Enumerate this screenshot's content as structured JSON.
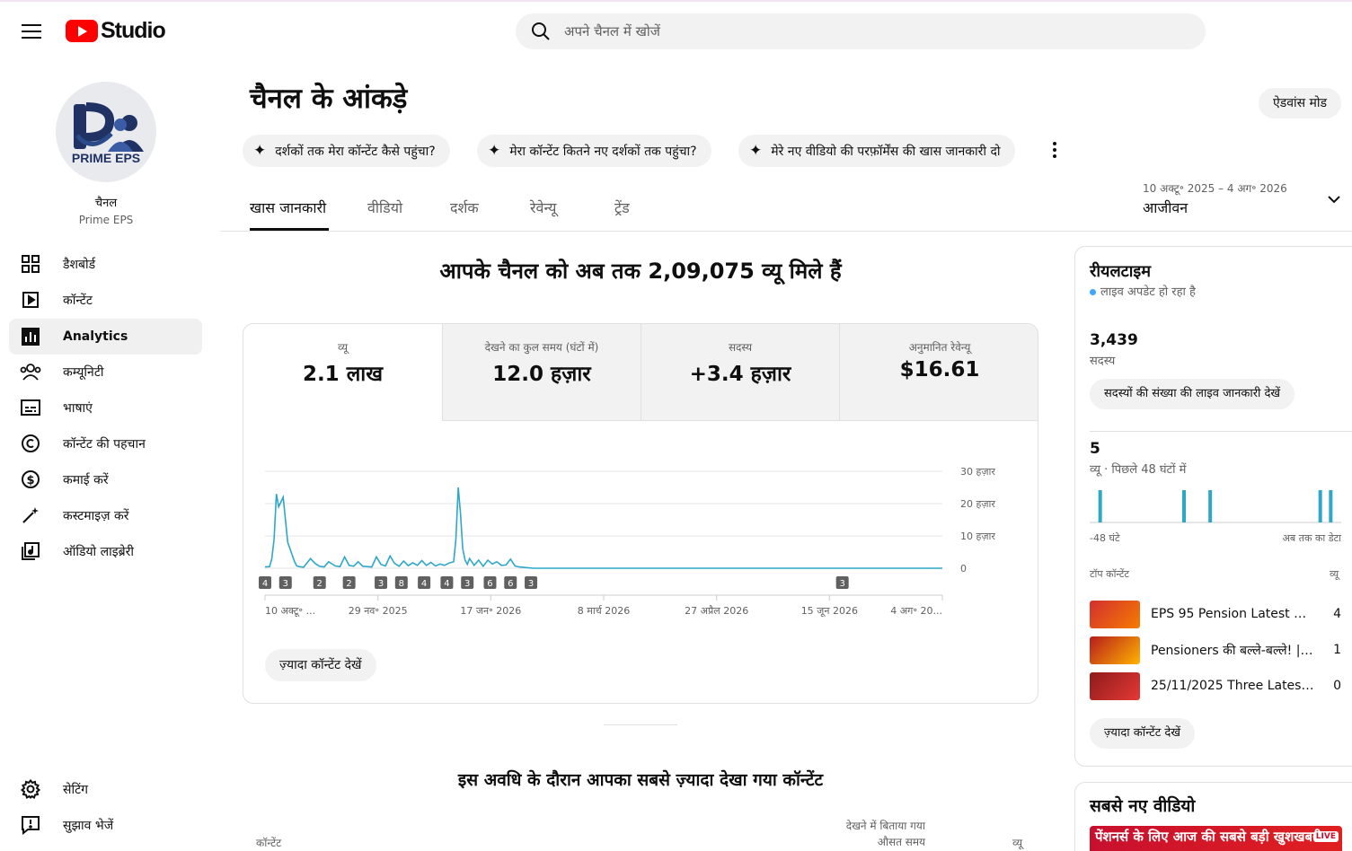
{
  "app": {
    "logo_text": "Studio"
  },
  "search": {
    "placeholder": "अपने चैनल में खोजें"
  },
  "channel": {
    "label": "चैनल",
    "name": "Prime EPS",
    "avatar_text": "PRIME EPS"
  },
  "sidebar": {
    "items": [
      {
        "label": "डैशबोर्ड",
        "icon": "dashboard-icon"
      },
      {
        "label": "कॉन्टेंट",
        "icon": "content-icon"
      },
      {
        "label": "Analytics",
        "icon": "analytics-icon",
        "active": true
      },
      {
        "label": "कम्यूनिटी",
        "icon": "community-icon"
      },
      {
        "label": "भाषाएं",
        "icon": "subtitles-icon"
      },
      {
        "label": "कॉन्टेंट की पहचान",
        "icon": "copyright-icon"
      },
      {
        "label": "कमाई करें",
        "icon": "dollar-icon"
      },
      {
        "label": "कस्टमाइज़ करें",
        "icon": "magic-wand-icon"
      },
      {
        "label": "ऑडियो लाइब्रेरी",
        "icon": "audio-library-icon"
      }
    ],
    "bottom": [
      {
        "label": "सेटिंग",
        "icon": "gear-icon"
      },
      {
        "label": "सुझाव भेजें",
        "icon": "feedback-icon"
      }
    ]
  },
  "main": {
    "title": "चैनल के आंकड़े",
    "advanced_mode": "ऐडवांस मोड",
    "chips": [
      "दर्शकों तक मेरा कॉन्टेंट कैसे पहुंचा?",
      "मेरा कॉन्टेंट कितने नए दर्शकों तक पहुंचा?",
      "मेरे नए वीडियो की परफ़ॉर्मेंस की खास जानकारी दो"
    ],
    "tabs": [
      "खास जानकारी",
      "वीडियो",
      "दर्शक",
      "रेवेन्यू",
      "ट्रेंड"
    ],
    "date_range": {
      "dates": "10 अक्टू॰ 2025 – 4 अग॰ 2026",
      "label": "आजीवन"
    },
    "headline": "आपके चैनल को अब तक 2,09,075 व्यू मिले हैं",
    "metrics": [
      {
        "label": "व्यू",
        "value": "2.1 लाख"
      },
      {
        "label": "देखने का कुल समय (घंटों में)",
        "value": "12.0 हज़ार"
      },
      {
        "label": "सदस्य",
        "value": "+3.4 हज़ार"
      },
      {
        "label": "अनुमानित रेवेन्यू",
        "value": "$16.61"
      }
    ],
    "more_content": "ज़्यादा कॉन्टेंट देखें",
    "top_content_title": "इस अवधि के दौरान आपका सबसे ज़्यादा देखा गया कॉन्टेंट",
    "table_headers": {
      "content": "कॉन्टेंट",
      "avg_watch_line1": "देखने में बिताया गया",
      "avg_watch_line2": "औसत समय",
      "views": "व्यू"
    }
  },
  "chart_data": {
    "type": "line",
    "x": [
      "2025-10-10",
      "2025-10-12",
      "2025-10-13",
      "2025-10-14",
      "2025-10-15",
      "2025-10-16",
      "2025-10-18",
      "2025-10-20",
      "2025-10-23",
      "2025-10-24",
      "2025-10-25",
      "2025-10-27",
      "2025-10-30",
      "2025-11-01",
      "2025-11-03",
      "2025-11-05",
      "2025-11-07",
      "2025-11-10",
      "2025-11-12",
      "2025-11-14",
      "2025-11-16",
      "2025-11-18",
      "2025-11-20",
      "2025-11-22",
      "2025-11-24",
      "2025-11-26",
      "2025-11-28",
      "2025-11-30",
      "2025-12-02",
      "2025-12-04",
      "2025-12-06",
      "2025-12-08",
      "2025-12-10",
      "2025-12-12",
      "2025-12-14",
      "2025-12-16",
      "2025-12-18",
      "2025-12-20",
      "2025-12-22",
      "2025-12-24",
      "2025-12-26",
      "2025-12-28",
      "2025-12-30",
      "2026-01-01",
      "2026-01-02",
      "2026-01-03",
      "2026-01-04",
      "2026-01-05",
      "2026-01-06",
      "2026-01-07",
      "2026-01-08",
      "2026-01-10",
      "2026-01-12",
      "2026-01-14",
      "2026-01-16",
      "2026-01-18",
      "2026-01-20",
      "2026-01-22",
      "2026-01-24",
      "2026-01-26",
      "2026-01-28",
      "2026-01-30",
      "2026-02-02",
      "2026-02-05",
      "2026-03-01",
      "2026-04-15",
      "2026-06-01",
      "2026-07-15",
      "2026-08-04"
    ],
    "y": [
      400,
      500,
      3000,
      9000,
      23000,
      19000,
      22000,
      8000,
      2000,
      700,
      500,
      300,
      3000,
      1500,
      600,
      400,
      2000,
      700,
      500,
      3500,
      900,
      600,
      2000,
      600,
      500,
      400,
      3500,
      1200,
      700,
      3800,
      1500,
      600,
      2200,
      800,
      1700,
      900,
      2400,
      900,
      1800,
      700,
      1300,
      900,
      1600,
      2000,
      9000,
      25000,
      17000,
      6000,
      2500,
      1200,
      3000,
      900,
      2500,
      600,
      2500,
      1300,
      2000,
      900,
      1000,
      2800,
      700,
      400,
      200,
      0,
      0,
      0,
      0,
      0,
      0
    ],
    "xtick_labels": [
      "10 अक्टू॰ ...",
      "29 नव॰ 2025",
      "17 जन॰ 2026",
      "8 मार्च 2026",
      "27 अप्रैल 2026",
      "15 जून 2026",
      "4 अग॰ 20..."
    ],
    "ytick_labels": [
      "30 हज़ार",
      "20 हज़ार",
      "10 हज़ार",
      "0"
    ],
    "ylim": [
      0,
      30000
    ],
    "xlim": [
      "2025-10-10",
      "2026-08-04"
    ],
    "grid": true,
    "color": "#2fa7c9",
    "markers": [
      {
        "x": "2025-10-10",
        "label": "4"
      },
      {
        "x": "2025-10-19",
        "label": "3"
      },
      {
        "x": "2025-11-03",
        "label": "2"
      },
      {
        "x": "2025-11-16",
        "label": "2"
      },
      {
        "x": "2025-11-30",
        "label": "3"
      },
      {
        "x": "2025-12-09",
        "label": "8"
      },
      {
        "x": "2025-12-19",
        "label": "4"
      },
      {
        "x": "2025-12-29",
        "label": "4"
      },
      {
        "x": "2026-01-07",
        "label": "3"
      },
      {
        "x": "2026-01-17",
        "label": "6"
      },
      {
        "x": "2026-01-26",
        "label": "6"
      },
      {
        "x": "2026-02-04",
        "label": "3"
      },
      {
        "x": "2026-06-21",
        "label": "3"
      }
    ]
  },
  "realtime": {
    "title": "रीयलटाइम",
    "live_text": "लाइव अपडेट हो रहा है",
    "subscribers": "3,439",
    "subscribers_label": "सदस्य",
    "subscribers_btn": "सदस्यों की संख्या की लाइव जानकारी देखें",
    "views": "5",
    "views_label": "व्यू · पिछले 48 घंटों में",
    "bar_start": "-48 घंटे",
    "bar_end": "अब तक का डेटा",
    "bars": {
      "hours_ago": [
        46,
        30,
        25,
        4,
        2
      ],
      "values": [
        1,
        1,
        1,
        1,
        1
      ]
    },
    "top_content_header": "टॉप कॉन्टेंट",
    "views_header": "व्यू",
    "top_content": [
      {
        "title": "EPS 95 Pension Latest Ne...",
        "views": "4"
      },
      {
        "title": "Pensioners की बल्ले-बल्ले! | E...",
        "views": "1"
      },
      {
        "title": "25/11/2025 Three Latest U...",
        "views": "0"
      }
    ],
    "more_content": "ज़्यादा कॉन्टेंट देखें"
  },
  "latest": {
    "title": "सबसे नए वीडियो",
    "thumb_text": "पेंशनर्स के लिए आज की सबसे बड़ी खुशखबरी",
    "live_badge": "LIVE"
  }
}
